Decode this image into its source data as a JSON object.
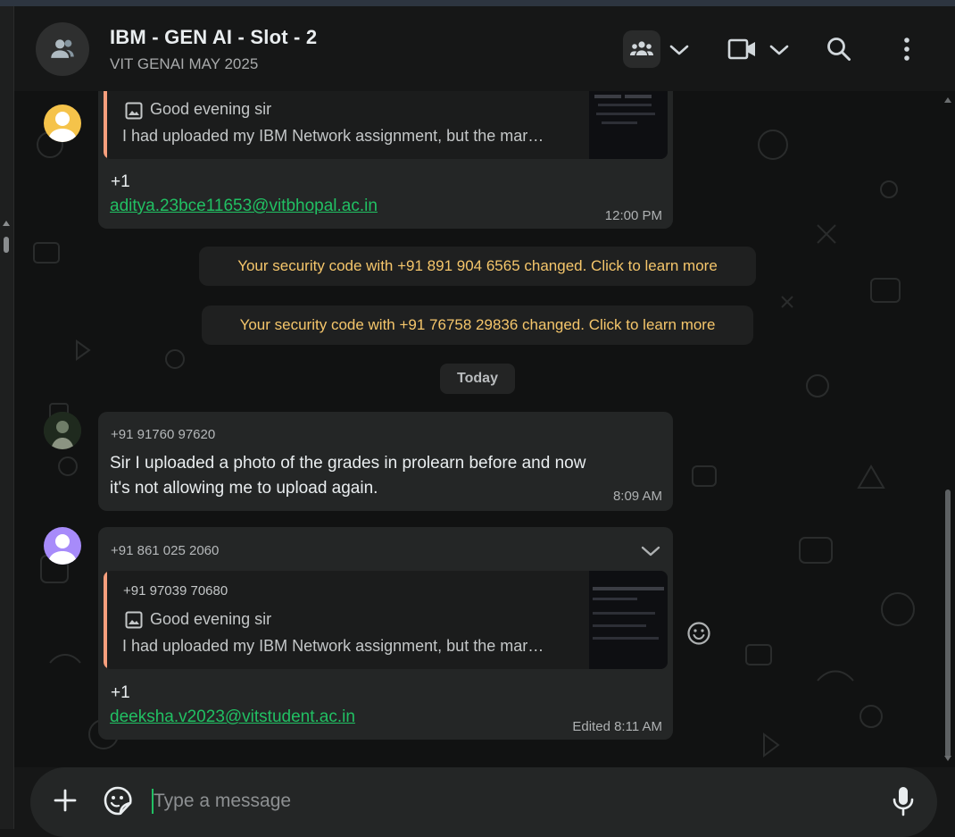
{
  "header": {
    "title": "IBM - GEN AI - Slot - 2",
    "subtitle": "VIT GENAI MAY 2025",
    "icons": [
      "group-avatar-icon",
      "community-icon",
      "chevron-down-icon",
      "video-call-icon",
      "chevron-down-icon",
      "search-icon",
      "menu-dots-icon"
    ]
  },
  "messages": [
    {
      "quote_caption": "Good evening sir",
      "quote_text": "I had uploaded my IBM Network assignment, but the mar…",
      "body": "+1",
      "link": "aditya.23bce11653@vitbhopal.ac.in",
      "time": "12:00 PM"
    },
    {
      "sender": "+91 91760 97620",
      "body_line1": "Sir I uploaded a photo of the grades in prolearn before and now",
      "body_line2": "it's not allowing me to upload again.",
      "time": "8:09 AM"
    },
    {
      "sender": "+91 861 025 2060",
      "quote_sender": "+91 97039 70680",
      "quote_caption": "Good evening sir",
      "quote_text": "I had uploaded my IBM Network assignment, but the mar…",
      "body": "+1",
      "link": "deeksha.v2023@vitstudent.ac.in",
      "time": "Edited 8:11 AM"
    }
  ],
  "system": [
    "Your security code with +91 891 904 6565 changed. Click to learn more",
    "Your security code with +91 76758 29836 changed. Click to learn more"
  ],
  "date_divider": "Today",
  "composer": {
    "placeholder": "Type a message"
  },
  "colors": {
    "accent": "#21c063",
    "system_text": "#f5c66b",
    "quote_bar": "#f79f7d",
    "bubble": "#242626",
    "background": "#111212"
  }
}
